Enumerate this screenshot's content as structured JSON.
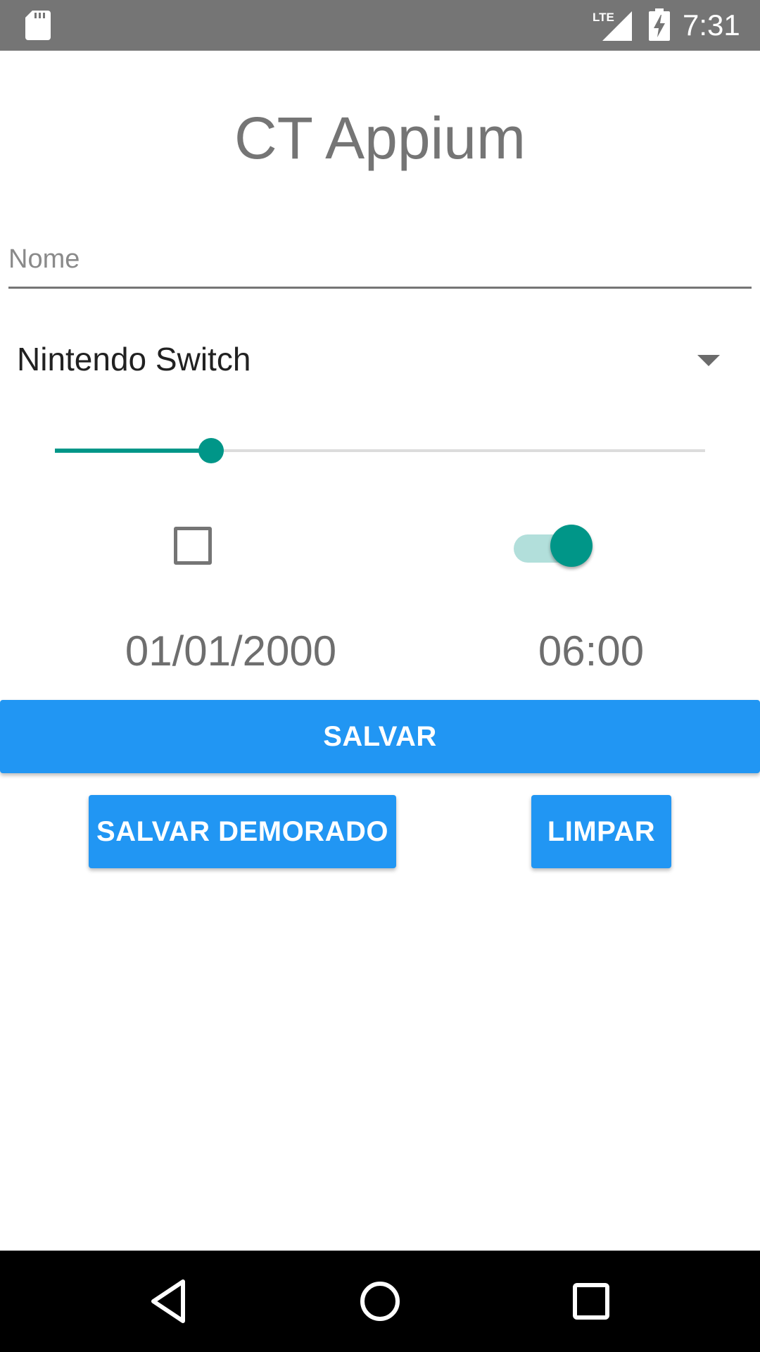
{
  "status_bar": {
    "time": "7:31",
    "network_label": "LTE",
    "icons": [
      "sd-card-icon",
      "lte-signal-icon",
      "battery-charging-icon"
    ]
  },
  "app": {
    "title": "CT Appium"
  },
  "form": {
    "name_placeholder": "Nome",
    "name_value": "",
    "console_selected": "Nintendo Switch",
    "slider_value_fraction": 0.24,
    "checkbox_checked": false,
    "switch_on": true,
    "date": "01/01/2000",
    "time": "06:00"
  },
  "buttons": {
    "save": "SALVAR",
    "save_delayed": "SALVAR DEMORADO",
    "clear": "LIMPAR"
  },
  "nav_bar": {
    "icons": [
      "back-icon",
      "home-icon",
      "recents-icon"
    ]
  },
  "colors": {
    "status_bar": "#757575",
    "accent": "#009688",
    "accent_light": "#b2dfdb",
    "button": "#2196f3",
    "text_gray": "#757575",
    "nav_bar": "#000000"
  }
}
